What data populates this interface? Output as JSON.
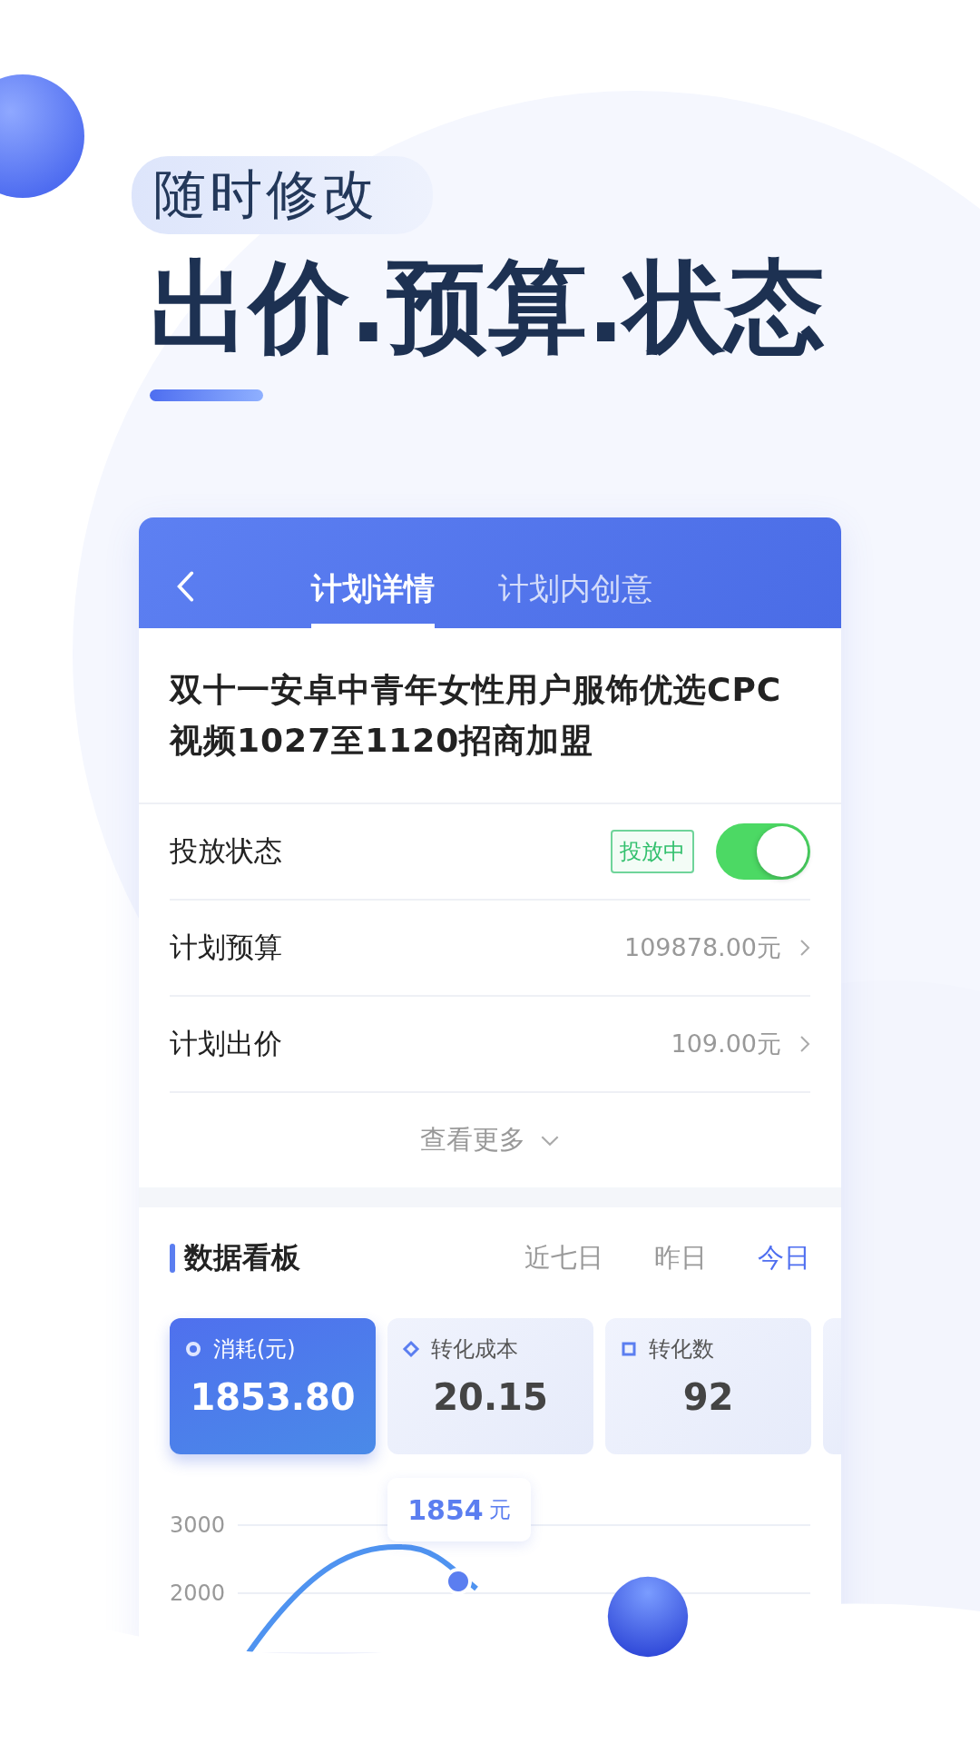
{
  "headline": {
    "tag": "随时修改",
    "title": "出价.预算.状态"
  },
  "tabs": [
    {
      "label": "计划详情",
      "selected": true
    },
    {
      "label": "计划内创意",
      "selected": false
    }
  ],
  "plan_title": "双十一安卓中青年女性用户服饰优选CPC视频1027至1120招商加盟",
  "rows": [
    {
      "kind": "toggle",
      "label": "投放状态",
      "badge": "投放中",
      "on": true
    },
    {
      "kind": "value",
      "label": "计划预算",
      "value": "109878.00元"
    },
    {
      "kind": "value",
      "label": "计划出价",
      "value": "109.00元"
    }
  ],
  "more": "查看更多",
  "dashboard": {
    "title": "数据看板",
    "periods": [
      {
        "label": "近七日",
        "selected": false
      },
      {
        "label": "昨日",
        "selected": false
      },
      {
        "label": "今日",
        "selected": true
      }
    ],
    "metrics": [
      {
        "label": "消耗(元)",
        "value": "1853.80",
        "selected": true
      },
      {
        "label": "转化成本",
        "value": "20.15",
        "selected": false
      },
      {
        "label": "转化数",
        "value": "92",
        "selected": false
      }
    ],
    "chart": {
      "y_labels": [
        "3000",
        "2000"
      ],
      "tooltip_value": "1854",
      "tooltip_unit": "元"
    }
  }
}
